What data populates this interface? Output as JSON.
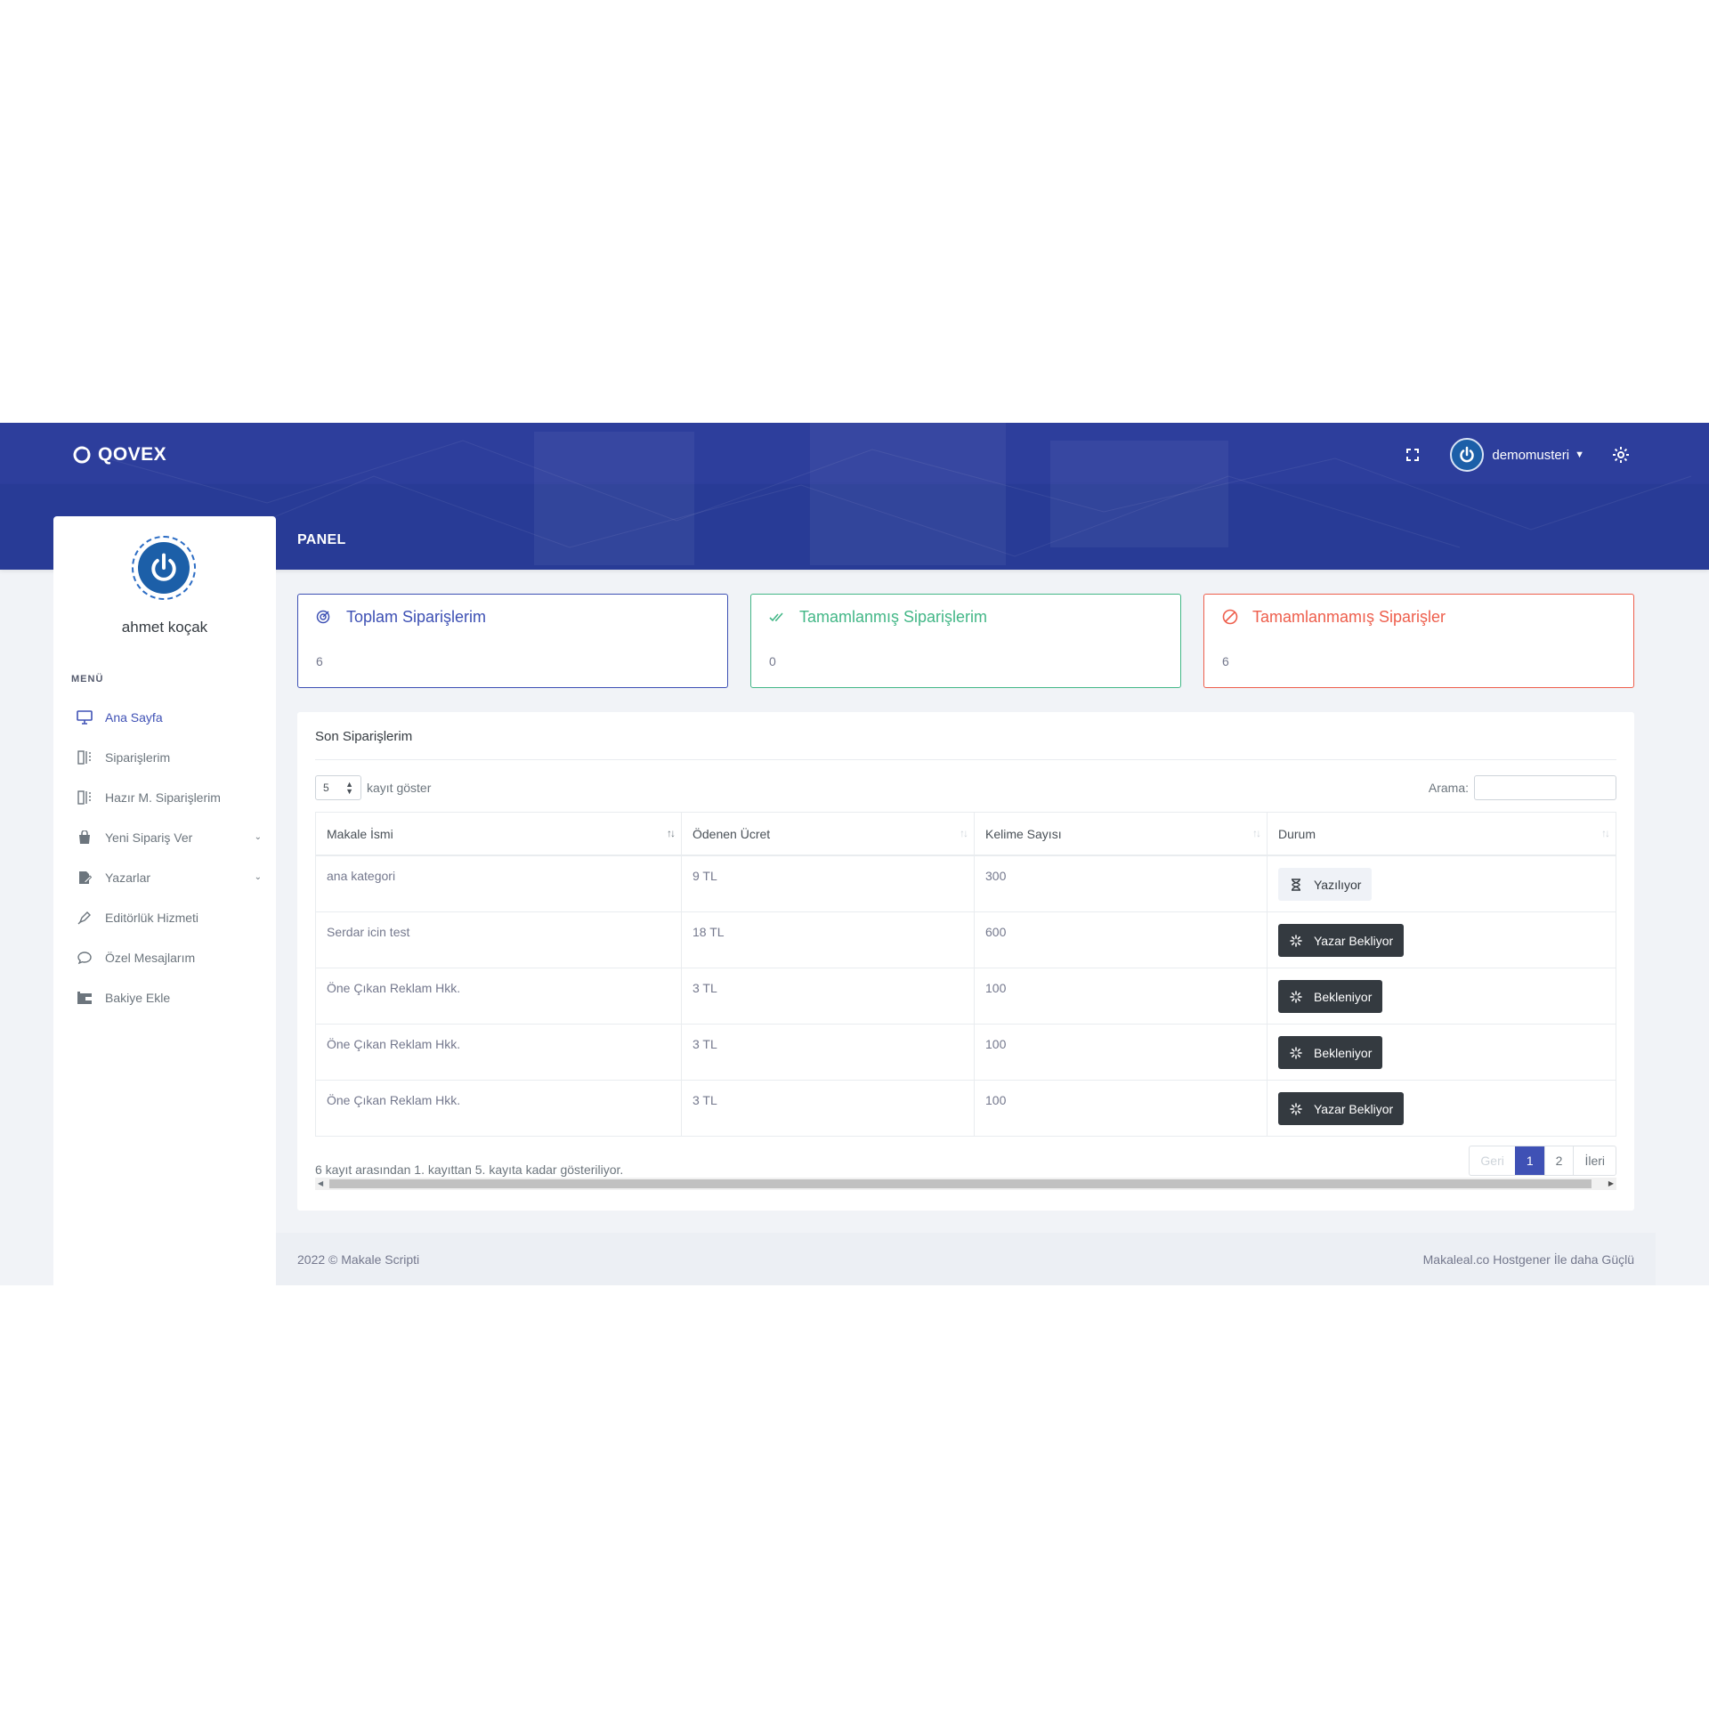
{
  "brand": {
    "name": "QOVEX"
  },
  "header": {
    "username": "demomusteri",
    "page_title": "PANEL"
  },
  "profile": {
    "name": "ahmet koçak"
  },
  "menu": {
    "title": "MENÜ",
    "items": [
      {
        "label": "Ana Sayfa",
        "icon": "monitor-icon"
      },
      {
        "label": "Siparişlerim",
        "icon": "columns-icon"
      },
      {
        "label": "Hazır M. Siparişlerim",
        "icon": "columns-icon"
      },
      {
        "label": "Yeni Sipariş Ver",
        "icon": "shopping-bag-icon"
      },
      {
        "label": "Yazarlar",
        "icon": "file-edit-icon"
      },
      {
        "label": "Editörlük Hizmeti",
        "icon": "pen-icon"
      },
      {
        "label": "Özel Mesajlarım",
        "icon": "chat-icon"
      },
      {
        "label": "Bakiye Ekle",
        "icon": "wallet-icon"
      }
    ]
  },
  "stats": [
    {
      "title": "Toplam Siparişlerim",
      "value": "6",
      "color": "#3d50b4"
    },
    {
      "title": "Tamamlanmış Siparişlerim",
      "value": "0",
      "color": "#43b787"
    },
    {
      "title": "Tamamlanmamış Siparişler",
      "value": "6",
      "color": "#ee5e4c"
    }
  ],
  "orders": {
    "title": "Son Siparişlerim",
    "length_value": "5",
    "length_label": "kayıt göster",
    "search_label": "Arama:",
    "columns": [
      "Makale İsmi",
      "Ödenen Ücret",
      "Kelime Sayısı",
      "Durum"
    ],
    "rows": [
      {
        "name": "ana kategori",
        "price": "9 TL",
        "words": "300",
        "status": "Yazılıyor"
      },
      {
        "name": "Serdar icin test",
        "price": "18 TL",
        "words": "600",
        "status": "Yazar Bekliyor"
      },
      {
        "name": "Öne Çıkan Reklam Hkk.",
        "price": "3 TL",
        "words": "100",
        "status": "Bekleniyor"
      },
      {
        "name": "Öne Çıkan Reklam Hkk.",
        "price": "3 TL",
        "words": "100",
        "status": "Bekleniyor"
      },
      {
        "name": "Öne Çıkan Reklam Hkk.",
        "price": "3 TL",
        "words": "100",
        "status": "Yazar Bekliyor"
      }
    ],
    "info": "6 kayıt arasından 1. kayıttan 5. kayıta kadar gösteriliyor.",
    "pager": {
      "prev": "Geri",
      "pages": [
        "1",
        "2"
      ],
      "next": "İleri"
    }
  },
  "footer": {
    "left": "2022 © Makale Scripti",
    "right": "Makaleal.co Hostgener İle daha Güçlü"
  },
  "colors": {
    "topbar": "#2d3e9c",
    "accent": "#3f51b5",
    "dark_badge": "#343a40"
  }
}
